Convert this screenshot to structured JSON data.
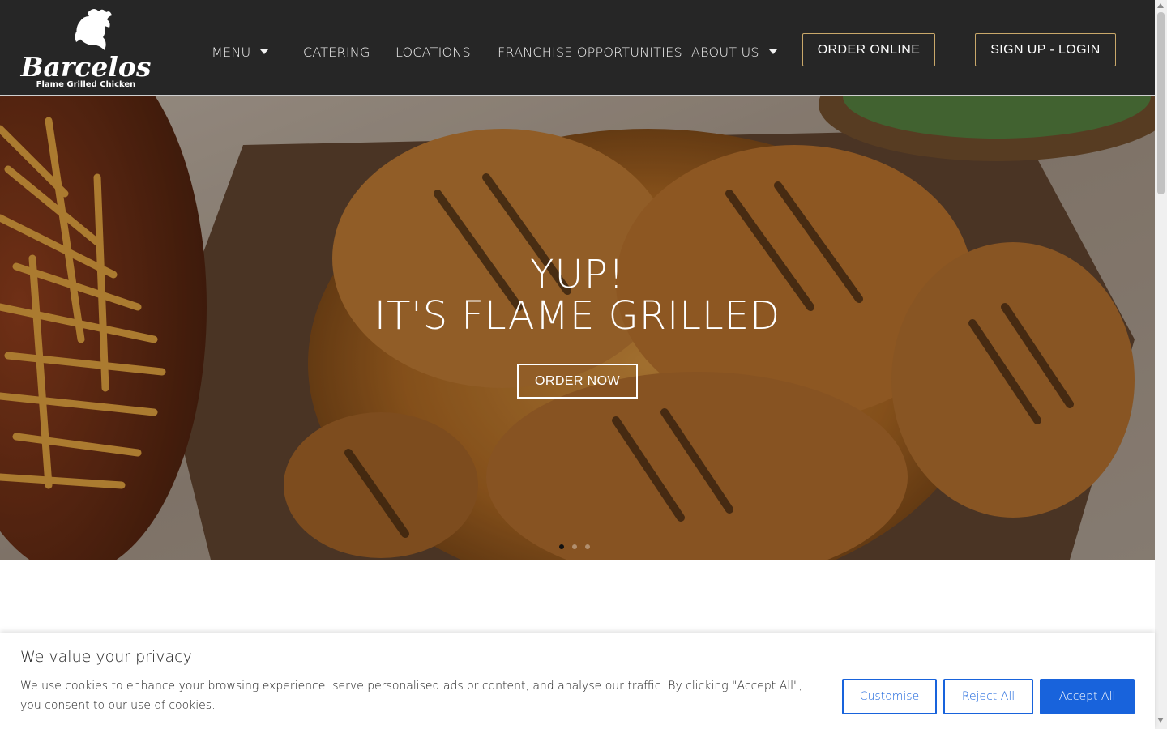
{
  "brand": {
    "name": "Barcelos",
    "tagline": "Flame Grilled Chicken"
  },
  "nav": {
    "items": [
      {
        "label": "MENU",
        "has_dropdown": true
      },
      {
        "label": "CATERING",
        "has_dropdown": false
      },
      {
        "label": "LOCATIONS",
        "has_dropdown": false
      },
      {
        "label": "FRANCHISE OPPORTUNITIES",
        "has_dropdown": false
      },
      {
        "label": "ABOUT US",
        "has_dropdown": true
      }
    ],
    "order_online": "ORDER ONLINE",
    "signup_login": "SIGN UP - LOGIN"
  },
  "hero": {
    "line1": "YUP!",
    "line2": "IT'S FLAME GRILLED",
    "cta": "ORDER NOW",
    "slides": 3,
    "active_slide": 1
  },
  "cookie": {
    "title": "We value your privacy",
    "text": "We use cookies to enhance your browsing experience, serve personalised ads or content, and analyse our traffic. By clicking \"Accept All\", you consent to our use of cookies.",
    "customise": "Customise",
    "reject": "Reject All",
    "accept": "Accept All"
  },
  "colors": {
    "header_bg": "#262626",
    "button_border": "#c9a86a",
    "cookie_accent": "#1863dc"
  }
}
